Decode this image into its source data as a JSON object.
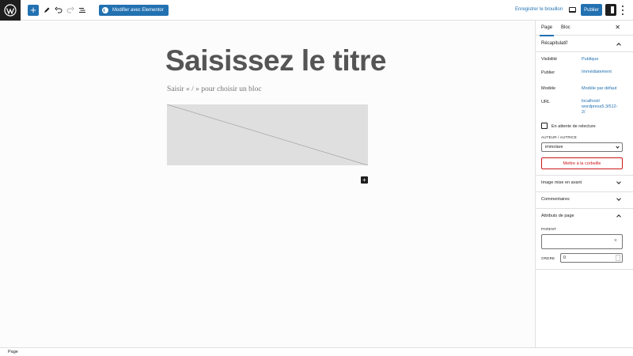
{
  "toolbar": {
    "wp_logo_icon": "wordpress-logo",
    "add_block_symbol": "+",
    "tools_icon": "pencil-icon",
    "undo_icon": "undo-icon",
    "redo_icon": "redo-icon",
    "list_view_icon": "list-view-icon",
    "elementor_label": "Modifier avec Elementor",
    "save_draft_label": "Enregistrer le brouillon",
    "preview_icon": "desktop-icon",
    "publish_label": "Publier",
    "settings_icon": "sidebar-toggle-icon",
    "more_icon": "more-vertical-icon",
    "accent_color": "#2271b1"
  },
  "editor": {
    "title_placeholder": "Saisissez le titre",
    "block_placeholder": "Saisir « / » pour choisir un bloc",
    "image_placeholder_icon": "image-placeholder",
    "inserter_symbol": "+"
  },
  "sidebar": {
    "tabs": [
      {
        "label": "Page",
        "active": true
      },
      {
        "label": "Bloc",
        "active": false
      }
    ],
    "close_symbol": "✕",
    "summary": {
      "title": "Récapitulatif",
      "rows": [
        {
          "label": "Visibilité",
          "value": "Publique"
        },
        {
          "label": "Publier",
          "value": "Immédiatement"
        },
        {
          "label": "Modèle",
          "value": "Modèle par défaut"
        },
        {
          "label": "URL",
          "value": "localhost/ wordpress5.3/512-2/"
        }
      ],
      "pending_review_label": "En attente de relecture",
      "pending_review_checked": false,
      "author_label": "AUTEUR / AUTRICE",
      "author_value": "immolare",
      "trash_label": "Mettre à la corbeille",
      "danger_color": "#cc1818"
    },
    "sections": [
      {
        "title": "Image mise en avant",
        "expanded": false
      },
      {
        "title": "Commentaires",
        "expanded": false
      },
      {
        "title": "Attributs de page",
        "expanded": true
      }
    ],
    "page_attributes": {
      "parent_label": "PARENT",
      "parent_value": "",
      "clear_symbol": "×",
      "order_label": "ORDRE",
      "order_value": "0"
    }
  },
  "footer": {
    "breadcrumb": "Page"
  }
}
